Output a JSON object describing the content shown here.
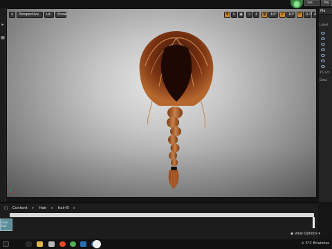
{
  "window": {
    "tabs": [
      "sss",
      "Ma"
    ]
  },
  "viewport": {
    "toolbar": {
      "menu_icon": "down-arrow-icon",
      "perspective_label": "Perspective",
      "lit_label": "Lit",
      "show_label": "Show",
      "grid_value": "10°",
      "rotation_value": "10°",
      "scale_value": "0.25",
      "camera_speed_value": "4"
    },
    "accent_color": "#d08a2c",
    "background_color": "#c6c6c6"
  },
  "right_panel": {
    "header_label": "Ma",
    "label_text": "Label",
    "item_count_text": "15 act",
    "details_label": "Deta"
  },
  "content_browser": {
    "breadcrumb": [
      "Content",
      "Hair",
      "hair-8"
    ],
    "asset_label": "Groo hair",
    "view_options_label": "View Options"
  },
  "taskbar": {
    "tray_text": "5°C Eclaircies"
  }
}
